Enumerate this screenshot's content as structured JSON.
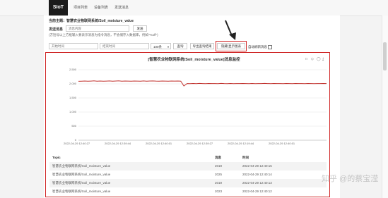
{
  "nav": {
    "brand": "SIoT",
    "items": [
      {
        "label": "项目列表"
      },
      {
        "label": "设备列表"
      },
      {
        "label": "发送消息"
      }
    ]
  },
  "topic": {
    "label": "当前主题：智慧农业物联网系统/Soil_moisture_value"
  },
  "send": {
    "label": "发送消息",
    "placeholder": "消息内容",
    "button": "发送",
    "hint": "(方括号以上方框输入要表示消息为指令消息，不会储存入数据库，例如\"%off\")"
  },
  "filter": {
    "start_placeholder": "开始时间",
    "end_placeholder": "结束时间",
    "count_value": "100条",
    "query_button": "查询",
    "export_button": "导出查询结果",
    "chart_toggle_button": "隐藏/显示图表",
    "auto_refresh_label": "自动刷新消息"
  },
  "chart": {
    "toolbar": [
      "□",
      "◇",
      "◯",
      "⤓"
    ]
  },
  "chart_data": {
    "type": "line",
    "title": "[智慧农业物联网系统/Soil_moisture_value]消息监控",
    "ylim": [
      0,
      2500
    ],
    "yticks": [
      "2,500",
      "2,000",
      "1,500",
      "1,000",
      "500",
      "0"
    ],
    "xticks": [
      "2022-04-29 12:40:27",
      "2022-04-29 12:39:44",
      "2022-04-29 12:40:01",
      "2022-04-29 12:39:27",
      "2022-04-29 12:19:44",
      "2022-04-29 12:40:01"
    ],
    "grid": true,
    "series": [
      {
        "color": "#c23531",
        "values": [
          2090,
          2095,
          2100,
          2092,
          2098,
          2105,
          2095,
          2100,
          2093,
          2097,
          2102,
          2096,
          2099,
          2104,
          2095,
          2100,
          2097,
          2093,
          2101,
          2098,
          2094,
          2102,
          2096,
          2099,
          2103,
          2097,
          2094,
          2100,
          2098,
          2095,
          2101,
          2097,
          2100,
          2096,
          1925,
          2010,
          2005,
          2012,
          2008,
          2015,
          2010,
          2006,
          2013,
          2009,
          2011,
          2007,
          2014,
          2010,
          2008,
          2012,
          2006,
          2011,
          2009,
          2013,
          2010,
          2007,
          2012,
          2008,
          2011,
          2009,
          2014,
          2010,
          2007,
          2012,
          2009,
          2011,
          2008,
          2013,
          2010,
          2006,
          2012,
          2009,
          2011,
          2008,
          2012,
          2010,
          2007,
          2011,
          2009,
          2012,
          2010
        ]
      }
    ]
  },
  "table": {
    "headers": [
      "Topic",
      "消息",
      "时间"
    ],
    "rows": [
      [
        "智慧农业物联网系统/Soil_moisture_value",
        "2019",
        "2022-04-29 12:40:15"
      ],
      [
        "智慧农业物联网系统/Soil_moisture_value",
        "2025",
        "2022-04-29 12:40:14"
      ],
      [
        "智慧农业物联网系统/Soil_moisture_value",
        "2019",
        "2022-04-29 12:40:13"
      ],
      [
        "智慧农业物联网系统/Soil_moisture_value",
        "2023",
        "2022-04-29 12:40:12"
      ]
    ]
  },
  "watermark": "知乎 @的蔡宝滢"
}
